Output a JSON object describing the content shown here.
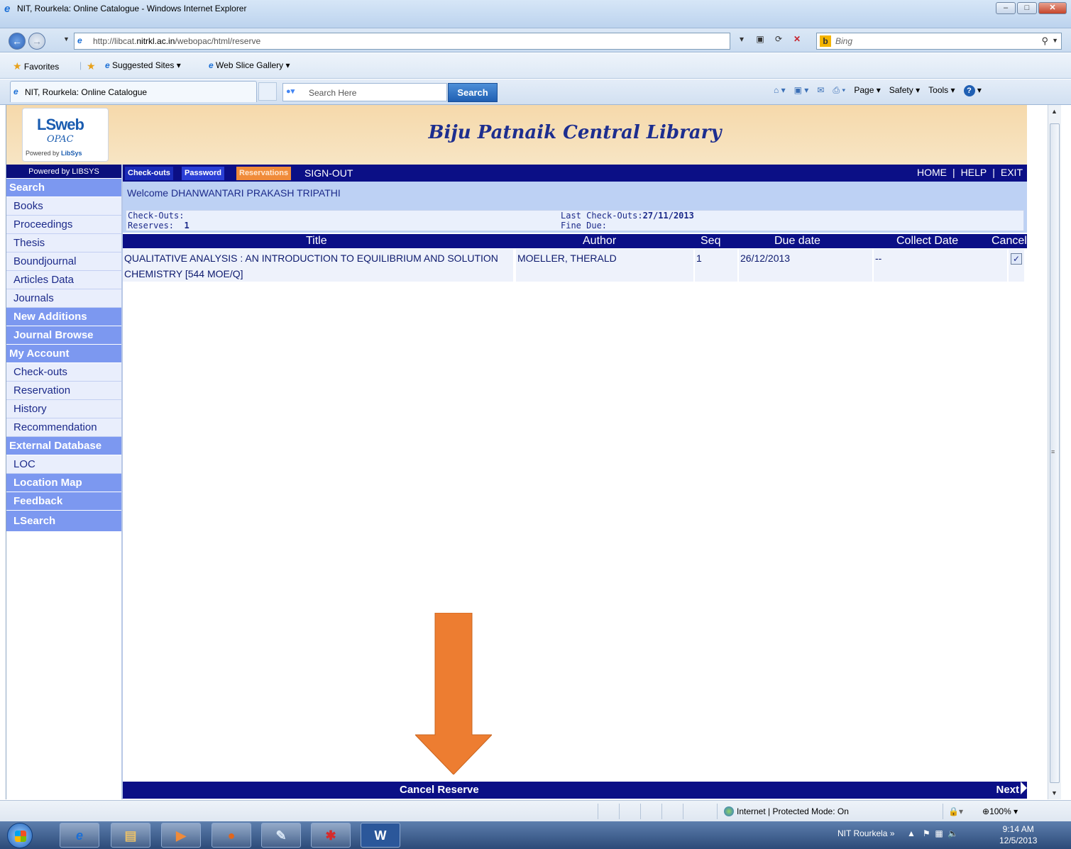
{
  "window": {
    "title": "NIT, Rourkela: Online Catalogue - Windows Internet Explorer",
    "buttons": {
      "minimize": "–",
      "maximize": "□",
      "close": "✕"
    }
  },
  "address_bar": {
    "url_prefix": "http://libcat.",
    "url_domain": "nitrkl.ac.in",
    "url_suffix": "/webopac/html/reserve",
    "search_placeholder": "Bing"
  },
  "favorites_bar": {
    "favorites_label": "Favorites",
    "suggested_sites": "Suggested Sites ▾",
    "web_slice_gallery": "Web Slice Gallery ▾"
  },
  "tab_bar": {
    "active_tab": "NIT, Rourkela: Online Catalogue",
    "search_placeholder": "Search Here",
    "search_button": "Search",
    "commands": {
      "page": "Page ▾",
      "safety": "Safety ▾",
      "tools": "Tools ▾"
    }
  },
  "header": {
    "logo_main": "LSweb",
    "logo_sub": "OPAC",
    "logo_powered": "Powered by",
    "logo_brand": "LibSys",
    "library_name": "Biju Patnaik Central Library"
  },
  "sidebar": {
    "powered_by": "Powered by LIBSYS",
    "items": [
      {
        "label": "Search",
        "type": "header"
      },
      {
        "label": "Books",
        "type": "item"
      },
      {
        "label": "Proceedings",
        "type": "item"
      },
      {
        "label": "Thesis",
        "type": "item"
      },
      {
        "label": "Boundjournal",
        "type": "item"
      },
      {
        "label": "Articles Data",
        "type": "item"
      },
      {
        "label": "Journals",
        "type": "item"
      },
      {
        "label": "New Additions",
        "type": "header-indent"
      },
      {
        "label": "Journal Browse",
        "type": "header-indent"
      },
      {
        "label": "My Account",
        "type": "header"
      },
      {
        "label": "Check-outs",
        "type": "item"
      },
      {
        "label": "Reservation",
        "type": "item"
      },
      {
        "label": "History",
        "type": "item"
      },
      {
        "label": "Recommendation",
        "type": "item"
      },
      {
        "label": "External Database",
        "type": "header"
      },
      {
        "label": "LOC",
        "type": "item"
      },
      {
        "label": "Location Map",
        "type": "header-indent"
      },
      {
        "label": "Feedback",
        "type": "header-indent"
      },
      {
        "label": "LSearch",
        "type": "header-indent"
      }
    ]
  },
  "top_nav": {
    "checkouts": "Check-outs",
    "password": "Password",
    "reservations": "Reservations",
    "sign_out": "SIGN-OUT",
    "home": "HOME",
    "help": "HELP",
    "exit": "EXIT",
    "separator": "|"
  },
  "account": {
    "welcome": "Welcome DHANWANTARI PRAKASH TRIPATHI",
    "checkouts_label": "Check-Outs:",
    "checkouts_value": "",
    "reserves_label": "Reserves:",
    "reserves_value": "1",
    "last_checkouts_label": "Last Check-Outs:",
    "last_checkouts_value": "27/11/2013",
    "fine_due_label": "Fine Due:",
    "fine_due_value": ""
  },
  "reservations_table": {
    "columns": [
      "Title",
      "Author",
      "Seq",
      "Due date",
      "Collect Date",
      "Cancel"
    ],
    "rows": [
      {
        "title": "QUALITATIVE ANALYSIS : AN INTRODUCTION TO EQUILIBRIUM AND SOLUTION CHEMISTRY [544 MOE/Q]",
        "author": "MOELLER, THERALD",
        "seq": "1",
        "due_date": "26/12/2013",
        "collect_date": "--",
        "cancel_checked": true
      }
    ]
  },
  "footer_bar": {
    "cancel_reserve": "Cancel Reserve",
    "next": "Next"
  },
  "annotation": {
    "arrow_color": "#ed7d31"
  },
  "status_bar": {
    "zone": "Internet | Protected Mode: On",
    "zoom": "100%"
  },
  "taskbar": {
    "network": "NIT Rourkela",
    "time": "9:14 AM",
    "date": "12/5/2013"
  }
}
